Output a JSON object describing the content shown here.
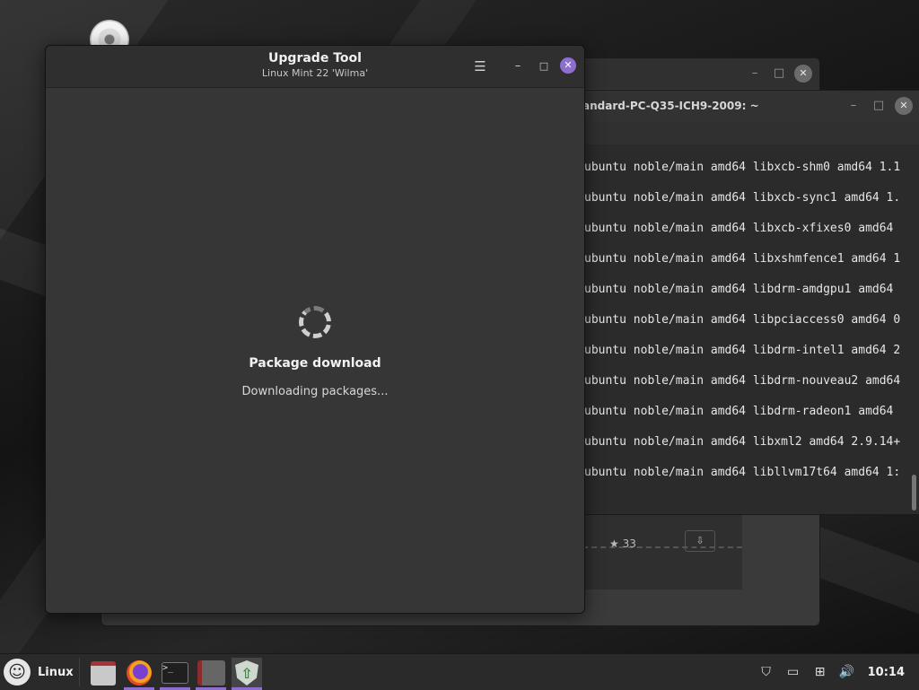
{
  "desktop": {
    "icons": [
      {
        "name": "cdrom-icon"
      }
    ]
  },
  "bg_window": {
    "controls": {
      "minimize": "–",
      "maximize": "□",
      "close": "✕"
    },
    "rating": "★ 33",
    "button": "⇩"
  },
  "terminal": {
    "title": "andard-PC-Q35-ICH9-2009: ~",
    "controls": {
      "minimize": "–",
      "maximize": "□",
      "close": "✕"
    },
    "lines": [
      "ubuntu noble/main amd64 libxcb-shm0 amd64 1.1",
      "ubuntu noble/main amd64 libxcb-sync1 amd64 1.",
      "ubuntu noble/main amd64 libxcb-xfixes0 amd64",
      "ubuntu noble/main amd64 libxshmfence1 amd64 1",
      "ubuntu noble/main amd64 libdrm-amdgpu1 amd64",
      "ubuntu noble/main amd64 libpciaccess0 amd64 0",
      "ubuntu noble/main amd64 libdrm-intel1 amd64 2",
      "ubuntu noble/main amd64 libdrm-nouveau2 amd64",
      "ubuntu noble/main amd64 libdrm-radeon1 amd64",
      "ubuntu noble/main amd64 libxml2 amd64 2.9.14+",
      "ubuntu noble/main amd64 libllvm17t64 amd64 1:"
    ]
  },
  "upgrade_tool": {
    "title": "Upgrade Tool",
    "subtitle": "Linux Mint 22 'Wilma'",
    "controls": {
      "menu": "☰",
      "minimize": "–",
      "maximize": "□",
      "close": "✕"
    },
    "status_title": "Package download",
    "status_text": "Downloading packages...",
    "accent_color": "#8e6fd0"
  },
  "taskbar": {
    "menu_label": "Linux",
    "menu_logo": "☺",
    "launchers": [
      {
        "name": "files-launcher",
        "icon": "folder-icon"
      },
      {
        "name": "firefox-launcher",
        "icon": "firefox-icon"
      },
      {
        "name": "terminal-launcher",
        "icon": "terminal-icon",
        "glyph": ">_"
      },
      {
        "name": "app-launcher",
        "icon": "app-icon"
      },
      {
        "name": "upgrade-tool-launcher",
        "icon": "shield-icon",
        "glyph": "⇧"
      }
    ],
    "tray": {
      "shield": "⛉",
      "display": "▭",
      "network": "⊞",
      "volume": "🔊"
    },
    "clock": "10:14"
  }
}
